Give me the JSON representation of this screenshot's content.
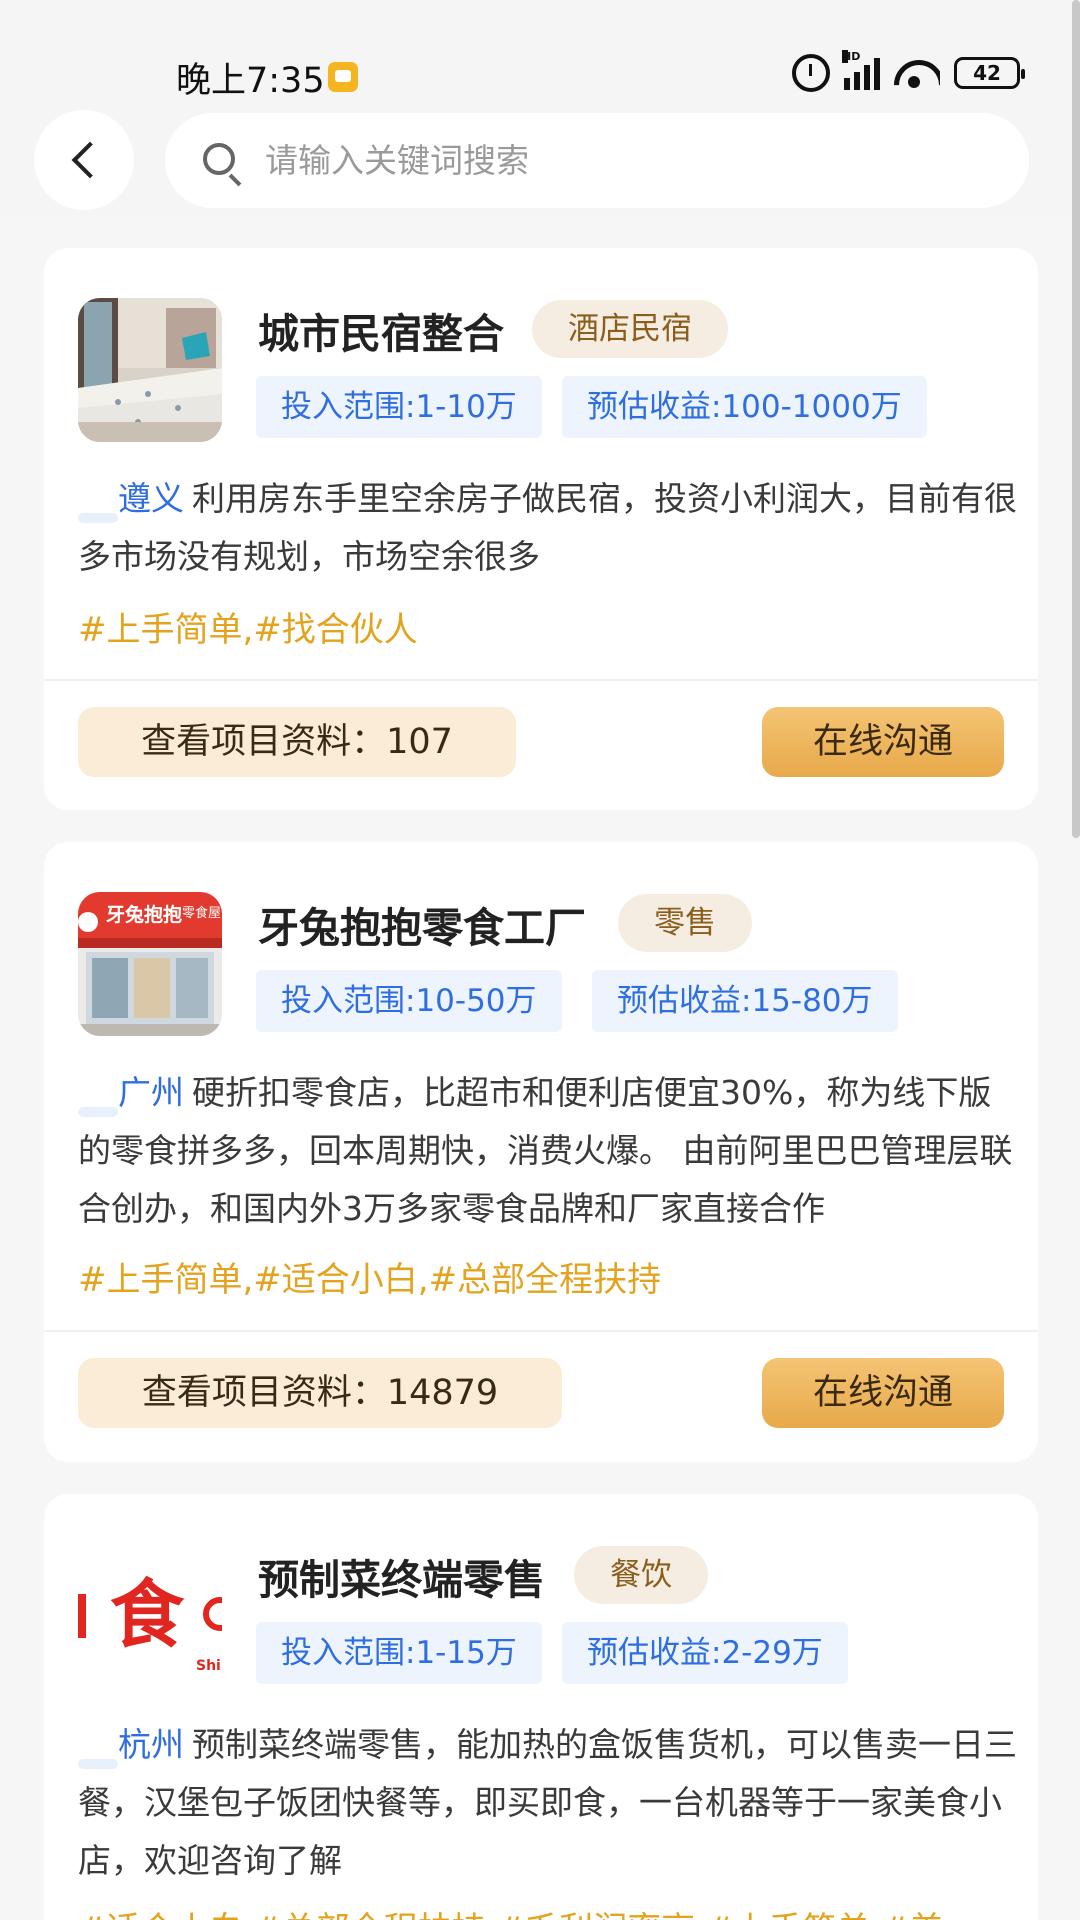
{
  "status_bar": {
    "time": "晚上7:35",
    "signal_label": "HD",
    "battery": "42"
  },
  "search": {
    "placeholder": "请输入关键词搜索",
    "value": ""
  },
  "cards": [
    {
      "title": "城市民宿整合",
      "category": "酒店民宿",
      "invest_range": "投入范围:1-10万",
      "est_income": "预估收益:100-1000万",
      "city": "遵义",
      "description": "利用房东手里空余房子做民宿，投资小利润大，目前有很多市场没有规划，市场空余很多",
      "hashtags": "#上手简单,#找合伙人",
      "view_label": "查看项目资料：107",
      "chat_label": "在线沟通"
    },
    {
      "title": "牙兔抱抱零食工厂",
      "category": "零售",
      "invest_range": "投入范围:10-50万",
      "est_income": "预估收益:15-80万",
      "city": "广州",
      "description": "硬折扣零食店，比超市和便利店便宜30%，称为线下版的零食拼多多，回本周期快，消费火爆。 由前阿里巴巴管理层联合创办，和国内外3万多家零食品牌和厂家直接合作",
      "hashtags": "#上手简单,#适合小白,#总部全程扶持",
      "view_label": "查看项目资料：14879",
      "chat_label": "在线沟通",
      "thumb_text": "牙兔抱抱",
      "thumb_subtext": "零食屋"
    },
    {
      "title": "预制菜终端零售",
      "category": "餐饮",
      "invest_range": "投入范围:1-15万",
      "est_income": "预估收益:2-29万",
      "city": "杭州",
      "description": "预制菜终端零售，能加热的盒饭售货机，可以售卖一日三餐，汉堡包子饭团快餐等，即买即食，一台机器等于一家美食小店，欢迎咨询了解",
      "hashtags": "#适合小白,#总部全程扶持,#毛利润率高,#上手简单,#美",
      "thumb_text": "食",
      "thumb_subtext": "Shi"
    }
  ],
  "colors": {
    "link_blue": "#2f6ee0",
    "hashtag_gold": "#e3a31e",
    "tag_bg": "#f5ede1",
    "button_gold": "#e8a94a"
  }
}
